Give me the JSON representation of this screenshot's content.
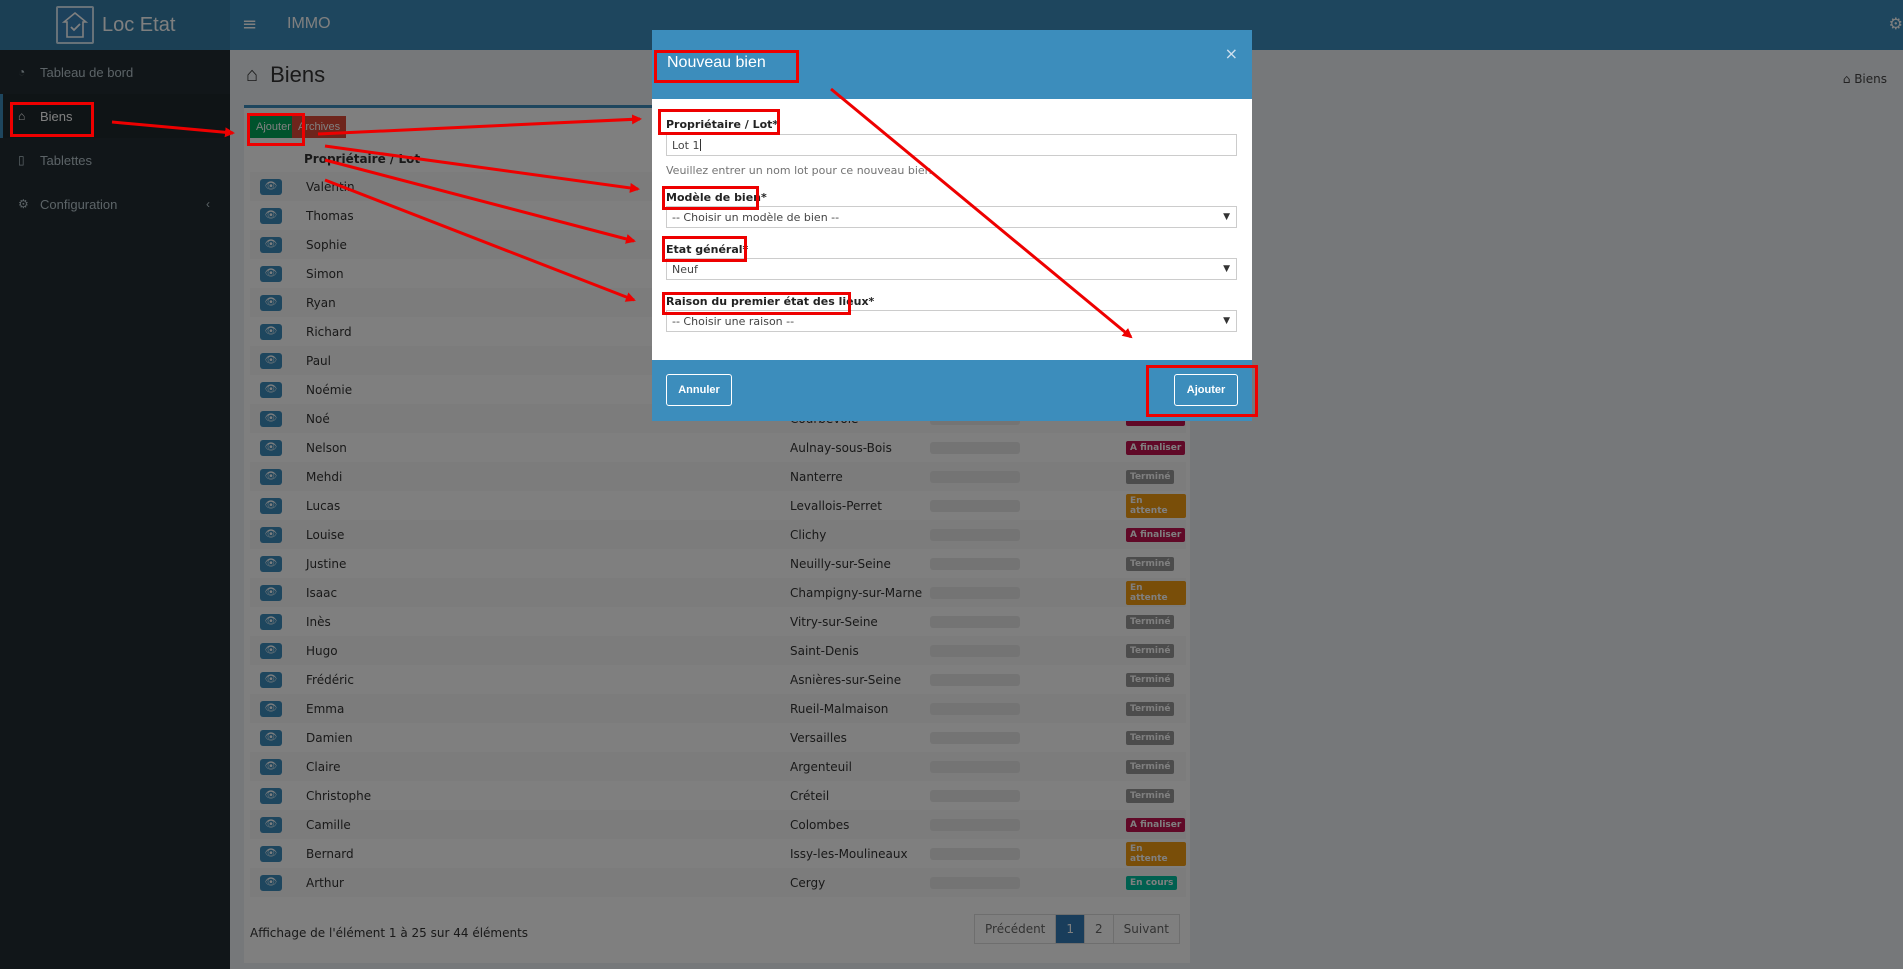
{
  "app": {
    "brand": "Loc Etat",
    "section": "IMMO"
  },
  "sidebar": {
    "items": [
      {
        "label": "Tableau de bord",
        "icon": "dashboard-icon"
      },
      {
        "label": "Biens",
        "icon": "home-icon"
      },
      {
        "label": "Tablettes",
        "icon": "tablet-icon"
      },
      {
        "label": "Configuration",
        "icon": "gears-icon"
      }
    ]
  },
  "page": {
    "title": "Biens",
    "breadcrumb": "Biens"
  },
  "toolbar": {
    "add_label": "Ajouter",
    "archives_label": "Archives"
  },
  "table": {
    "column_owner": "Propriétaire / Lot",
    "rows": [
      {
        "name": "Valentin",
        "city": "",
        "status": ""
      },
      {
        "name": "Thomas",
        "city": "",
        "status": ""
      },
      {
        "name": "Sophie",
        "city": "",
        "status": ""
      },
      {
        "name": "Simon",
        "city": "",
        "status": ""
      },
      {
        "name": "Ryan",
        "city": "",
        "status": ""
      },
      {
        "name": "Richard",
        "city": "",
        "status": ""
      },
      {
        "name": "Paul",
        "city": "",
        "status": ""
      },
      {
        "name": "Noémie",
        "city": "",
        "status": ""
      },
      {
        "name": "Noé",
        "city": "Courbevoie",
        "status": "A finaliser"
      },
      {
        "name": "Nelson",
        "city": "Aulnay-sous-Bois",
        "status": "A finaliser"
      },
      {
        "name": "Mehdi",
        "city": "Nanterre",
        "status": "Terminé"
      },
      {
        "name": "Lucas",
        "city": "Levallois-Perret",
        "status": "En attente"
      },
      {
        "name": "Louise",
        "city": "Clichy",
        "status": "A finaliser"
      },
      {
        "name": "Justine",
        "city": "Neuilly-sur-Seine",
        "status": "Terminé"
      },
      {
        "name": "Isaac",
        "city": "Champigny-sur-Marne",
        "status": "En attente"
      },
      {
        "name": "Inès",
        "city": "Vitry-sur-Seine",
        "status": "Terminé"
      },
      {
        "name": "Hugo",
        "city": "Saint-Denis",
        "status": "Terminé"
      },
      {
        "name": "Frédéric",
        "city": "Asnières-sur-Seine",
        "status": "Terminé"
      },
      {
        "name": "Emma",
        "city": "Rueil-Malmaison",
        "status": "Terminé"
      },
      {
        "name": "Damien",
        "city": "Versailles",
        "status": "Terminé"
      },
      {
        "name": "Claire",
        "city": "Argenteuil",
        "status": "Terminé"
      },
      {
        "name": "Christophe",
        "city": "Créteil",
        "status": "Terminé"
      },
      {
        "name": "Camille",
        "city": "Colombes",
        "status": "A finaliser"
      },
      {
        "name": "Bernard",
        "city": "Issy-les-Moulineaux",
        "status": "En attente"
      },
      {
        "name": "Arthur",
        "city": "Cergy",
        "status": "En cours"
      }
    ],
    "footer_info": "Affichage de l'élément 1 à 25 sur 44 éléments",
    "pagination": {
      "prev": "Précédent",
      "pages": [
        "1",
        "2"
      ],
      "next": "Suivant"
    }
  },
  "status_colors": {
    "A finaliser": "#c0134f",
    "Terminé": "#999999",
    "En attente": "#f39c12",
    "En cours": "#00c0a0"
  },
  "modal": {
    "title": "Nouveau bien",
    "fields": {
      "lot_label": "Propriétaire / Lot*",
      "lot_value": "Lot 1",
      "lot_help": "Veuillez entrer un nom lot pour ce nouveau bien",
      "model_label": "Modèle de bien*",
      "model_value": "-- Choisir un modèle de bien --",
      "state_label": "Etat général*",
      "state_value": "Neuf",
      "reason_label": "Raison du premier état des lieux*",
      "reason_value": "-- Choisir une raison --"
    },
    "cancel_label": "Annuler",
    "submit_label": "Ajouter",
    "close_symbol": "×"
  },
  "colors": {
    "primary": "#3c8dbc",
    "sidebar": "#222d32",
    "annotation": "#ee0000"
  }
}
